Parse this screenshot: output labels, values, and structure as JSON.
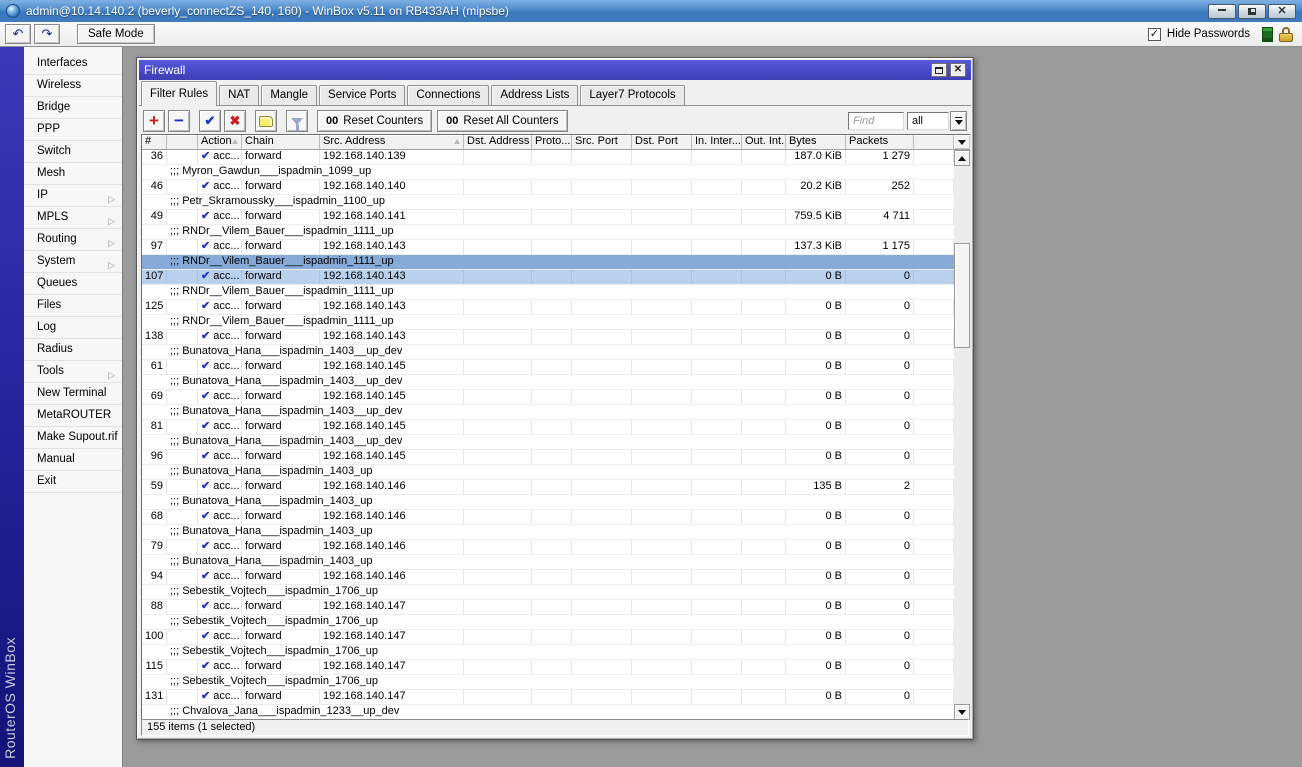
{
  "titlebar": {
    "title": "admin@10.14.140.2 (beverly_connectZS_140, 160) - WinBox v5.11 on RB433AH (mipsbe)"
  },
  "toolbar": {
    "safe_mode_label": "Safe Mode",
    "hide_passwords_label": "Hide Passwords",
    "hide_passwords_checked": true,
    "undo_icon": "↶",
    "redo_icon": "↷"
  },
  "brand": {
    "vertical_label": "RouterOS WinBox"
  },
  "sidebar": {
    "items": [
      {
        "label": "Interfaces"
      },
      {
        "label": "Wireless"
      },
      {
        "label": "Bridge"
      },
      {
        "label": "PPP"
      },
      {
        "label": "Switch"
      },
      {
        "label": "Mesh"
      },
      {
        "label": "IP",
        "has_submenu": true
      },
      {
        "label": "MPLS",
        "has_submenu": true
      },
      {
        "label": "Routing",
        "has_submenu": true
      },
      {
        "label": "System",
        "has_submenu": true
      },
      {
        "label": "Queues"
      },
      {
        "label": "Files"
      },
      {
        "label": "Log"
      },
      {
        "label": "Radius"
      },
      {
        "label": "Tools",
        "has_submenu": true
      },
      {
        "label": "New Terminal"
      },
      {
        "label": "MetaROUTER"
      },
      {
        "label": "Make Supout.rif"
      },
      {
        "label": "Manual"
      },
      {
        "label": "Exit"
      }
    ]
  },
  "firewall": {
    "title": "Firewall",
    "tabs": [
      "Filter Rules",
      "NAT",
      "Mangle",
      "Service Ports",
      "Connections",
      "Address Lists",
      "Layer7 Protocols"
    ],
    "active_tab": "Filter Rules",
    "toolbar": {
      "counter_prefix": "00",
      "reset_counters": "Reset Counters",
      "reset_all_counters": "Reset All Counters",
      "find_placeholder": "Find",
      "filter_value": "all"
    },
    "columns": [
      {
        "label": "#"
      },
      {
        "label": ""
      },
      {
        "label": "Action",
        "sorted": true
      },
      {
        "label": "Chain"
      },
      {
        "label": "Src. Address",
        "sorted": true
      },
      {
        "label": "Dst. Address"
      },
      {
        "label": "Proto..."
      },
      {
        "label": "Src. Port"
      },
      {
        "label": "Dst. Port"
      },
      {
        "label": "In. Inter..."
      },
      {
        "label": "Out. Int..."
      },
      {
        "label": "Bytes"
      },
      {
        "label": "Packets"
      },
      {
        "label": ""
      }
    ],
    "rows": [
      {
        "type": "rule",
        "num": "36",
        "action": "acc...",
        "chain": "forward",
        "src": "192.168.140.139",
        "bytes": "187.0 KiB",
        "packets": "1 279"
      },
      {
        "type": "comment",
        "text": ";;; Myron_Gawdun___ispadmin_1099_up"
      },
      {
        "type": "rule",
        "num": "46",
        "action": "acc...",
        "chain": "forward",
        "src": "192.168.140.140",
        "bytes": "20.2 KiB",
        "packets": "252"
      },
      {
        "type": "comment",
        "text": ";;; Petr_Skramoussky___ispadmin_1100_up"
      },
      {
        "type": "rule",
        "num": "49",
        "action": "acc...",
        "chain": "forward",
        "src": "192.168.140.141",
        "bytes": "759.5 KiB",
        "packets": "4 711"
      },
      {
        "type": "comment",
        "text": ";;; RNDr__Vilem_Bauer___ispadmin_1111_up"
      },
      {
        "type": "rule",
        "num": "97",
        "action": "acc...",
        "chain": "forward",
        "src": "192.168.140.143",
        "bytes": "137.3 KiB",
        "packets": "1 175"
      },
      {
        "type": "comment",
        "text": ";;; RNDr__Vilem_Bauer___ispadmin_1111_up",
        "selected": true
      },
      {
        "type": "rule",
        "num": "107",
        "action": "acc...",
        "chain": "forward",
        "src": "192.168.140.143",
        "bytes": "0 B",
        "packets": "0",
        "selected": true
      },
      {
        "type": "comment",
        "text": ";;; RNDr__Vilem_Bauer___ispadmin_1111_up"
      },
      {
        "type": "rule",
        "num": "125",
        "action": "acc...",
        "chain": "forward",
        "src": "192.168.140.143",
        "bytes": "0 B",
        "packets": "0"
      },
      {
        "type": "comment",
        "text": ";;; RNDr__Vilem_Bauer___ispadmin_1111_up"
      },
      {
        "type": "rule",
        "num": "138",
        "action": "acc...",
        "chain": "forward",
        "src": "192.168.140.143",
        "bytes": "0 B",
        "packets": "0"
      },
      {
        "type": "comment",
        "text": ";;; Bunatova_Hana___ispadmin_1403__up_dev"
      },
      {
        "type": "rule",
        "num": "61",
        "action": "acc...",
        "chain": "forward",
        "src": "192.168.140.145",
        "bytes": "0 B",
        "packets": "0"
      },
      {
        "type": "comment",
        "text": ";;; Bunatova_Hana___ispadmin_1403__up_dev"
      },
      {
        "type": "rule",
        "num": "69",
        "action": "acc...",
        "chain": "forward",
        "src": "192.168.140.145",
        "bytes": "0 B",
        "packets": "0"
      },
      {
        "type": "comment",
        "text": ";;; Bunatova_Hana___ispadmin_1403__up_dev"
      },
      {
        "type": "rule",
        "num": "81",
        "action": "acc...",
        "chain": "forward",
        "src": "192.168.140.145",
        "bytes": "0 B",
        "packets": "0"
      },
      {
        "type": "comment",
        "text": ";;; Bunatova_Hana___ispadmin_1403__up_dev"
      },
      {
        "type": "rule",
        "num": "96",
        "action": "acc...",
        "chain": "forward",
        "src": "192.168.140.145",
        "bytes": "0 B",
        "packets": "0"
      },
      {
        "type": "comment",
        "text": ";;; Bunatova_Hana___ispadmin_1403_up"
      },
      {
        "type": "rule",
        "num": "59",
        "action": "acc...",
        "chain": "forward",
        "src": "192.168.140.146",
        "bytes": "135 B",
        "packets": "2"
      },
      {
        "type": "comment",
        "text": ";;; Bunatova_Hana___ispadmin_1403_up"
      },
      {
        "type": "rule",
        "num": "68",
        "action": "acc...",
        "chain": "forward",
        "src": "192.168.140.146",
        "bytes": "0 B",
        "packets": "0"
      },
      {
        "type": "comment",
        "text": ";;; Bunatova_Hana___ispadmin_1403_up"
      },
      {
        "type": "rule",
        "num": "79",
        "action": "acc...",
        "chain": "forward",
        "src": "192.168.140.146",
        "bytes": "0 B",
        "packets": "0"
      },
      {
        "type": "comment",
        "text": ";;; Bunatova_Hana___ispadmin_1403_up"
      },
      {
        "type": "rule",
        "num": "94",
        "action": "acc...",
        "chain": "forward",
        "src": "192.168.140.146",
        "bytes": "0 B",
        "packets": "0"
      },
      {
        "type": "comment",
        "text": ";;; Sebestik_Vojtech___ispadmin_1706_up"
      },
      {
        "type": "rule",
        "num": "88",
        "action": "acc...",
        "chain": "forward",
        "src": "192.168.140.147",
        "bytes": "0 B",
        "packets": "0"
      },
      {
        "type": "comment",
        "text": ";;; Sebestik_Vojtech___ispadmin_1706_up"
      },
      {
        "type": "rule",
        "num": "100",
        "action": "acc...",
        "chain": "forward",
        "src": "192.168.140.147",
        "bytes": "0 B",
        "packets": "0"
      },
      {
        "type": "comment",
        "text": ";;; Sebestik_Vojtech___ispadmin_1706_up"
      },
      {
        "type": "rule",
        "num": "115",
        "action": "acc...",
        "chain": "forward",
        "src": "192.168.140.147",
        "bytes": "0 B",
        "packets": "0"
      },
      {
        "type": "comment",
        "text": ";;; Sebestik_Vojtech___ispadmin_1706_up"
      },
      {
        "type": "rule",
        "num": "131",
        "action": "acc...",
        "chain": "forward",
        "src": "192.168.140.147",
        "bytes": "0 B",
        "packets": "0"
      },
      {
        "type": "comment",
        "text": ";;; Chvalova_Jana___ispadmin_1233__up_dev"
      }
    ],
    "status": "155 items (1 selected)"
  },
  "colors": {
    "firewall_titlebar": "#4b4dcb",
    "selection_comment_row": "#86abd9",
    "selection_rule_row": "#b9d1ec",
    "accept_check": "#2333cc",
    "mdi_background": "#9b9b9b"
  }
}
